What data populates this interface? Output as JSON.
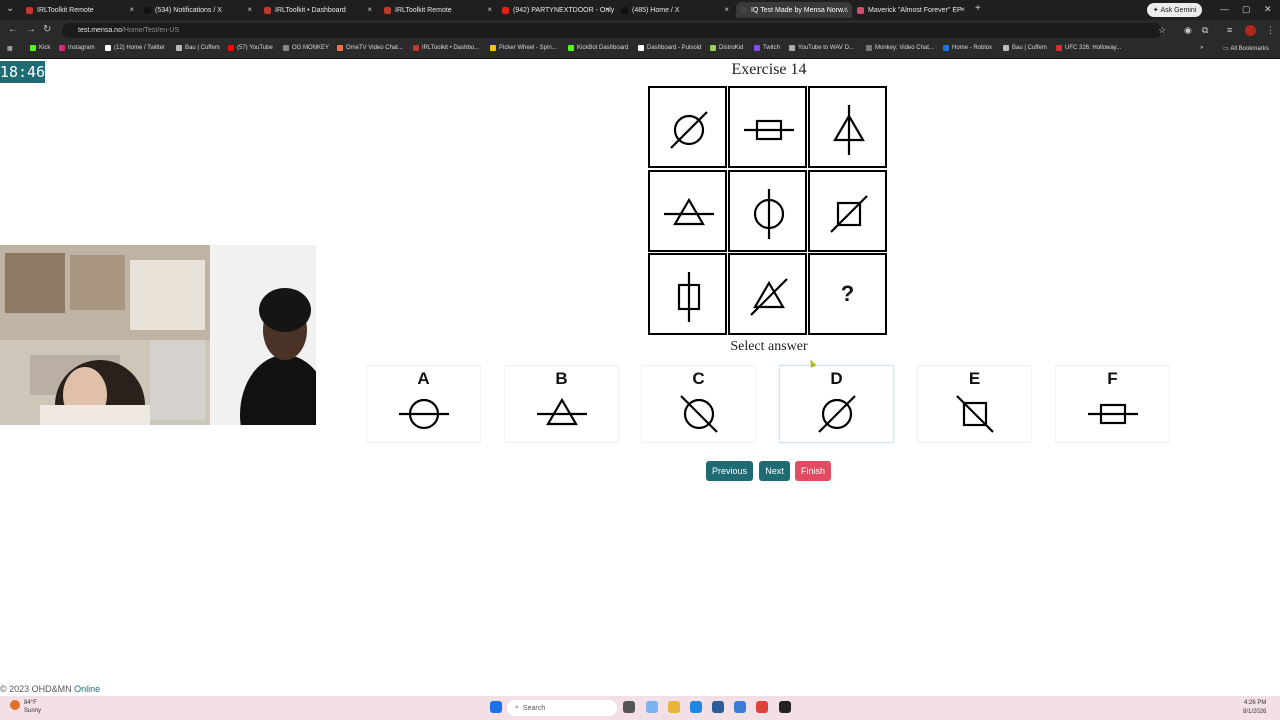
{
  "browser": {
    "tabs": [
      {
        "label": "IRLToolkit Remote",
        "color": "#c0392b"
      },
      {
        "label": "(534) Notifications / X",
        "color": "#111111"
      },
      {
        "label": "IRLToolkit • Dashboard",
        "color": "#c0392b"
      },
      {
        "label": "IRLToolkit Remote",
        "color": "#c0392b"
      },
      {
        "label": "(942) PARTYNEXTDOOR - Only",
        "color": "#e62117"
      },
      {
        "label": "(485) Home / X",
        "color": "#111111"
      },
      {
        "label": "IQ Test Made by Mensa Norw...",
        "color": "#444444"
      },
      {
        "label": "Maverick \"Almost Forever\" EP",
        "color": "#d64a6b"
      }
    ],
    "new_tab_icon": "+",
    "ask_gemini_label": "Ask Gemini",
    "url_host": "test.mensa.no",
    "url_path": "/Home/Test/en-US",
    "bookmarks": [
      "Kick",
      "Instagram",
      "(12) Home / Twitter",
      "Bau | Cuffem",
      "(57) YouTube",
      "OG MONKEY",
      "OmeTV Video Chat...",
      "IRLToolkit • Dashbo...",
      "Picker Wheel - Spin...",
      "KickBot Dashboard",
      "Dashboard - Pulsoid",
      "DistroKid",
      "Twitch",
      "YouTube to WAV D...",
      "Monkey: Video Chat...",
      "Home - Roblox",
      "Bau | Cuffem",
      "UFC 326: Holloway..."
    ],
    "all_bookmarks_label": "All Bookmarks"
  },
  "test": {
    "timer": "18:46",
    "title": "Exercise 14",
    "select_label": "Select answer",
    "puzzle": [
      "circle-slash",
      "rect-hline",
      "triangle-vline",
      "triangle-hline",
      "circle-vline",
      "square-slash",
      "rect-vline",
      "triangle-slash",
      "question"
    ],
    "question_mark": "?",
    "options": [
      {
        "letter": "A",
        "shape": "circle-hline"
      },
      {
        "letter": "B",
        "shape": "triangle-hline"
      },
      {
        "letter": "C",
        "shape": "circle-backslash"
      },
      {
        "letter": "D",
        "shape": "circle-slash"
      },
      {
        "letter": "E",
        "shape": "square-backslash"
      },
      {
        "letter": "F",
        "shape": "rect-hline"
      }
    ],
    "selected_option": "D",
    "buttons": {
      "previous": "Previous",
      "next": "Next",
      "finish": "Finish"
    },
    "colors": {
      "accent": "#1f6b73",
      "finish": "#e24c62"
    }
  },
  "footer": {
    "copyright": "© 2023 OHD&MN",
    "link": "Online"
  },
  "taskbar": {
    "weather_temp": "84°F",
    "weather_desc": "Sunny",
    "search_placeholder": "Search",
    "time": "4:26 PM",
    "date": "8/1/2026"
  }
}
